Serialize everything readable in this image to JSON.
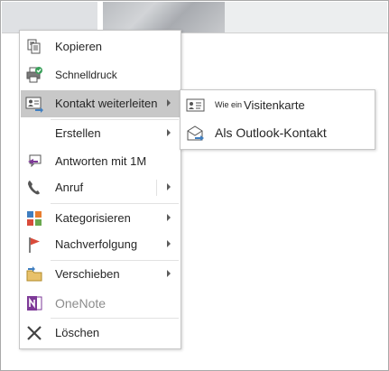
{
  "context_menu": {
    "items": [
      {
        "label": "Kopieren",
        "icon": "copy-icon"
      },
      {
        "label": "Schnelldruck",
        "icon": "quick-print-icon"
      },
      {
        "label": "Kontakt weiterleiten",
        "icon": "forward-contact-icon",
        "submenu": true,
        "highlighted": true
      },
      {
        "label": "Erstellen",
        "submenu": true
      },
      {
        "label": "Antworten mit 1M",
        "icon": "reply-im-icon"
      },
      {
        "label": "Anruf",
        "icon": "phone-icon",
        "submenu": true
      },
      {
        "label": "Kategorisieren",
        "icon": "categorize-icon",
        "submenu": true
      },
      {
        "label": "Nachverfolgung",
        "icon": "follow-up-flag-icon",
        "submenu": true
      },
      {
        "label": "Verschieben",
        "icon": "move-folder-icon",
        "submenu": true
      },
      {
        "label": "OneNote",
        "icon": "onenote-icon",
        "disabled": true
      },
      {
        "label": "Löschen",
        "icon": "delete-icon"
      }
    ]
  },
  "submenu": {
    "items": [
      {
        "prefix": "Wie ein",
        "label": "Visitenkarte",
        "icon": "business-card-icon"
      },
      {
        "label": "Als Outlook-Kontakt",
        "icon": "outlook-contact-icon"
      }
    ]
  },
  "colors": {
    "highlight": "#c8c8c8",
    "text": "#262626",
    "disabled_text": "#8c8c8c",
    "flag_red": "#d94b3a",
    "onenote_purple": "#7e3a98",
    "print_green": "#3aa05a",
    "category_orange": "#e87d2f",
    "category_blue": "#3f7ec0"
  }
}
